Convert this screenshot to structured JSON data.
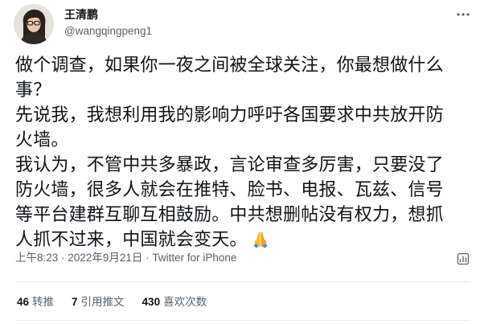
{
  "author": {
    "display_name": "王清鹏",
    "handle": "@wangqingpeng1"
  },
  "tweet": {
    "lines": [
      "做个调查，如果你一夜之间被全球关注，你最想做什么",
      "事？",
      "先说我，我想利用我的影响力呼吁各国要求中共放开防",
      "火墙。",
      "我认为，不管中共多暴政，言论审查多厉害，只要没了",
      "防火墙，很多人就会在推特、脸书、电报、瓦兹、信号",
      "等平台建群互聊互相鼓励。中共想删帖没有权力，想抓",
      "人抓不过来，中国就会变天。"
    ],
    "emoji": "folded-hands-emoji"
  },
  "meta": {
    "time": "上午8:23",
    "separator": " · ",
    "date": "2022年9月21日",
    "source": "Twitter for iPhone"
  },
  "stats": {
    "retweets_count": "46",
    "retweets_label": "转推",
    "quotes_count": "7",
    "quotes_label": "引用推文",
    "likes_count": "430",
    "likes_label": "喜欢次数"
  },
  "icons": {
    "more": "more-horizontal-icon",
    "analytics": "analytics-icon"
  },
  "colors": {
    "text_primary": "#0f1419",
    "text_secondary": "#536471",
    "divider": "#e7e9ea",
    "emoji": "#f5b82e"
  }
}
